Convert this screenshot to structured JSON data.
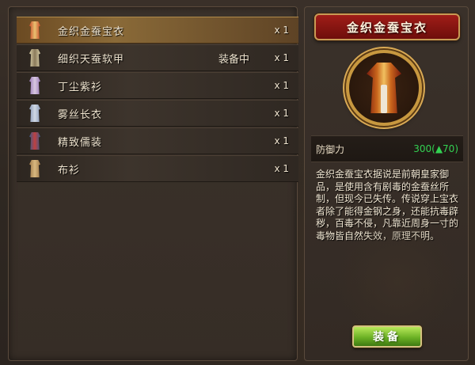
{
  "items": [
    {
      "name": "金织金蚕宝衣",
      "status": "",
      "qty": "x 1",
      "icon": "robe-icon",
      "color": "#c84a2a",
      "accent": "#e8c070"
    },
    {
      "name": "细织天蚕软甲",
      "status": "装备中",
      "qty": "x 1",
      "icon": "robe-icon",
      "color": "#d8cfa8",
      "accent": "#8a7a5a"
    },
    {
      "name": "丁尘紫衫",
      "status": "",
      "qty": "x 1",
      "icon": "robe-icon",
      "color": "#9a7ab8",
      "accent": "#d8c8e0"
    },
    {
      "name": "雾丝长衣",
      "status": "",
      "qty": "x 1",
      "icon": "robe-icon",
      "color": "#8a9ab8",
      "accent": "#d0d8e4"
    },
    {
      "name": "精致儒装",
      "status": "",
      "qty": "x 1",
      "icon": "robe-icon",
      "color": "#3a5a88",
      "accent": "#c04040"
    },
    {
      "name": "布衫",
      "status": "",
      "qty": "x 1",
      "icon": "robe-icon",
      "color": "#a07a4a",
      "accent": "#d8b880"
    }
  ],
  "selected_index": 0,
  "detail": {
    "title": "金织金蚕宝衣",
    "stat_label": "防御力",
    "stat_value": "300(▲70)",
    "description": "金织金蚕宝衣据说是前朝皇家御品，是使用含有剧毒的金蚕丝所制，但现今已失传。传说穿上宝衣者除了能得金钢之身，还能抗毒辟秽，百毒不侵，凡靠近周身一寸的毒物皆自然失效，原理不明。",
    "equip_button": "装备"
  },
  "colors": {
    "selected_row": "#8a6a38",
    "stat_green": "#33d152",
    "title_red": "#a01d18",
    "button_green": "#6cb225"
  }
}
